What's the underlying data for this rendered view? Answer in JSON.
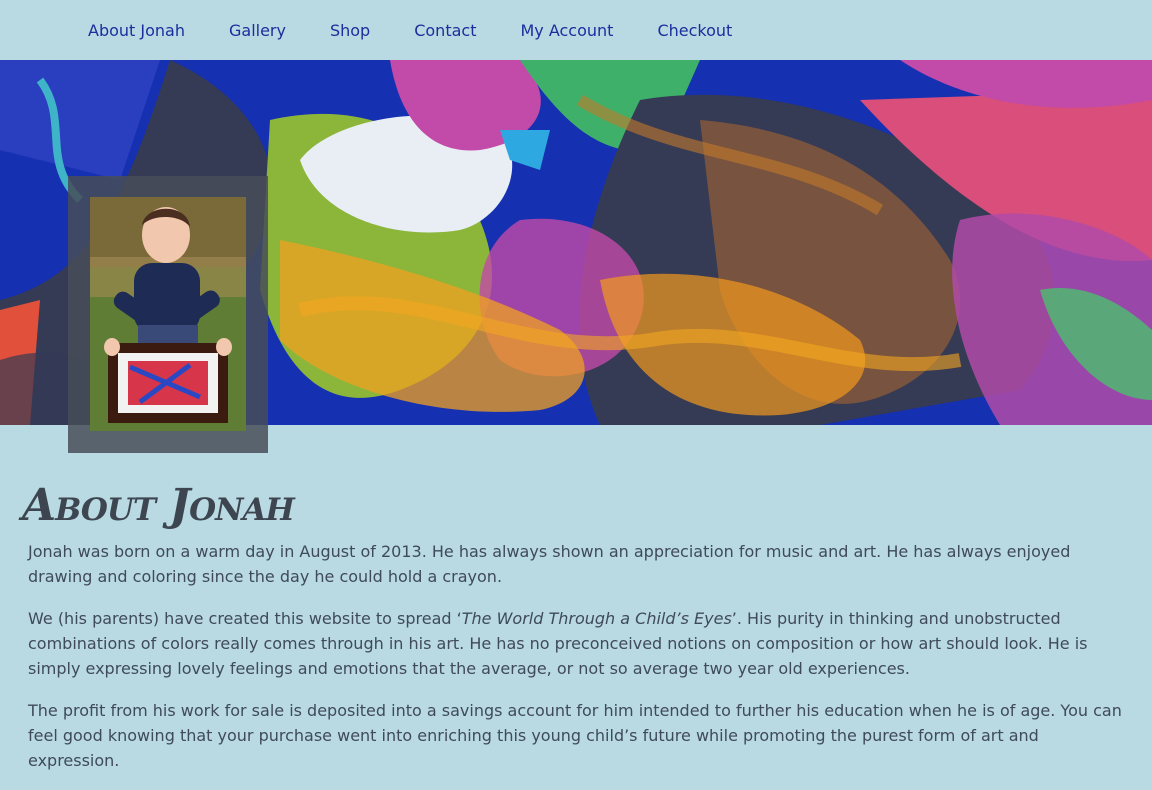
{
  "nav": {
    "items": [
      "About Jonah",
      "Gallery",
      "Shop",
      "Contact",
      "My Account",
      "Checkout"
    ]
  },
  "hero": {
    "alt_description_hidden": ""
  },
  "page": {
    "title": "About Jonah",
    "p1": "Jonah was born on a warm day in August of 2013. He has always shown an appreciation for music and art. He has always enjoyed drawing and coloring since the day he could hold a crayon.",
    "p2_before": "We (his parents) have created this website to spread ‘",
    "p2_italic": "The World Through a Child’s Eyes",
    "p2_after": "’. His purity in thinking and unobstructed combinations of colors really comes through in his art. He has no preconceived notions on composition or how art should look. He is simply expressing lovely feelings and emotions that the average, or not so average two year old experiences.",
    "p3": "The profit from his work for sale is deposited into a savings account for him intended to further his education when he is of age. You can feel good knowing that your purchase went into enriching this young child’s future while promoting the purest form of art and expression."
  },
  "colors": {
    "background": "#b9d9e3",
    "nav_link": "#1a2f9c",
    "text": "#3f4a5a"
  }
}
